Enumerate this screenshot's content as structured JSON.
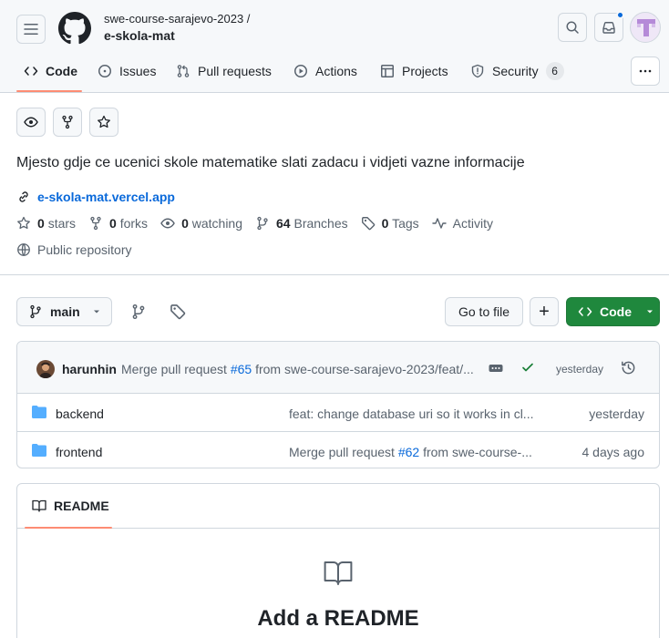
{
  "header": {
    "owner": "swe-course-sarajevo-2023 /",
    "repo": "e-skola-mat"
  },
  "tabs": [
    {
      "label": "Code",
      "icon": "code-icon",
      "selected": true
    },
    {
      "label": "Issues",
      "icon": "issue-icon"
    },
    {
      "label": "Pull requests",
      "icon": "pull-request-icon"
    },
    {
      "label": "Actions",
      "icon": "play-icon"
    },
    {
      "label": "Projects",
      "icon": "table-icon"
    },
    {
      "label": "Security",
      "icon": "shield-icon",
      "count": "6"
    }
  ],
  "repo": {
    "description": "Mjesto gdje ce ucenici skole matematike slati zadacu i vidjeti vazne informacije",
    "website": "e-skola-mat.vercel.app",
    "stars_count": "0",
    "stars_label": "stars",
    "forks_count": "0",
    "forks_label": "forks",
    "watching_count": "0",
    "watching_label": "watching",
    "branches_count": "64",
    "branches_label": "Branches",
    "tags_count": "0",
    "tags_label": "Tags",
    "activity_label": "Activity",
    "visibility": "Public repository"
  },
  "toolbar": {
    "branch": "main",
    "go_to_file": "Go to file",
    "add": "+",
    "code": "Code"
  },
  "latest_commit": {
    "author": "harunhin",
    "message_prefix": "Merge pull request ",
    "pr": "#65",
    "message_suffix": " from swe-course-sarajevo-2023/feat/...",
    "time": "yesterday"
  },
  "files": [
    {
      "name": "backend",
      "type": "folder",
      "message_prefix": "feat: change database uri so it works in cl...",
      "pr": "",
      "message_suffix": "",
      "time": "yesterday"
    },
    {
      "name": "frontend",
      "type": "folder",
      "message_prefix": "Merge pull request ",
      "pr": "#62",
      "message_suffix": " from swe-course-...",
      "time": "4 days ago"
    }
  ],
  "readme": {
    "tab": "README",
    "title": "Add a README"
  },
  "colors": {
    "accent_underline": "#fd8c73",
    "primary_button": "#1f883d",
    "link": "#0969da",
    "folder": "#54aeff"
  }
}
